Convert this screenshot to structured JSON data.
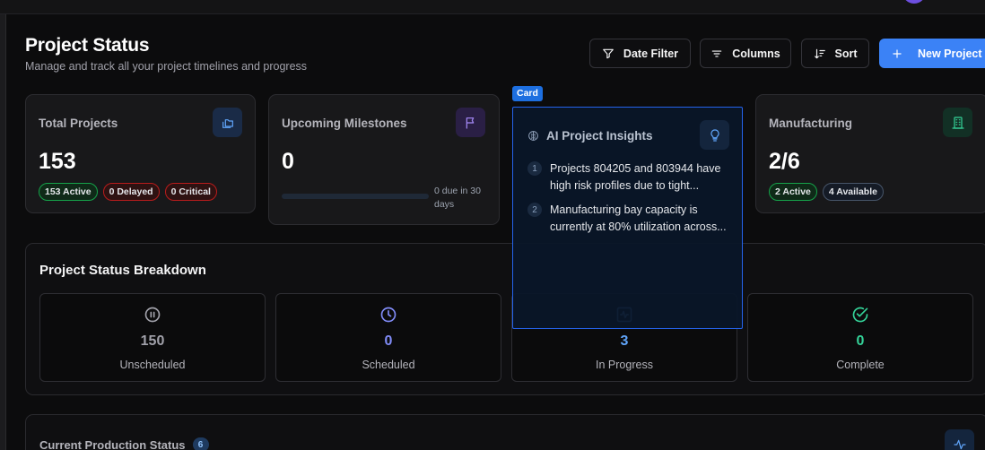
{
  "header": {
    "title": "Project Status",
    "subtitle": "Manage and track all your project timelines and progress"
  },
  "toolbar": {
    "date_filter_label": "Date Filter",
    "columns_label": "Columns",
    "sort_label": "Sort",
    "new_project_label": "New Project"
  },
  "cards": {
    "total": {
      "title": "Total Projects",
      "value": "153",
      "badges": [
        "153 Active",
        "0 Delayed",
        "0 Critical"
      ],
      "icon": "folders-icon"
    },
    "milestones": {
      "title": "Upcoming Milestones",
      "value": "0",
      "due_text": "0 due in 30 days",
      "progress": 0,
      "icon": "flag-icon"
    },
    "ai": {
      "tag": "Card",
      "title": "AI Project Insights",
      "insights": [
        {
          "num": "1",
          "text": "Projects 804205 and 803944 have high risk profiles due to tight..."
        },
        {
          "num": "2",
          "text": "Manufacturing bay capacity is currently at 80% utilization across..."
        }
      ],
      "icon": "lightbulb-icon"
    },
    "manufacturing": {
      "title": "Manufacturing",
      "value": "2/6",
      "badges": [
        "2 Active",
        "4 Available"
      ],
      "icon": "building-icon"
    }
  },
  "breakdown": {
    "title": "Project Status Breakdown",
    "statuses": [
      {
        "count": "150",
        "label": "Unscheduled",
        "icon": "pause-circle-icon",
        "color": "#a1a1aa"
      },
      {
        "count": "0",
        "label": "Scheduled",
        "icon": "clock-icon",
        "color": "#818cf8"
      },
      {
        "count": "3",
        "label": "In Progress",
        "icon": "activity-square-icon",
        "color": "#60a5fa"
      },
      {
        "count": "0",
        "label": "Complete",
        "icon": "check-circle-icon",
        "color": "#34d399"
      }
    ]
  },
  "production": {
    "title": "Current Production Status",
    "count": "6",
    "icon": "activity-icon"
  },
  "colors": {
    "accent": "#3b82f6",
    "active_green": "#16a34a",
    "delayed_red": "#b91c1c"
  }
}
